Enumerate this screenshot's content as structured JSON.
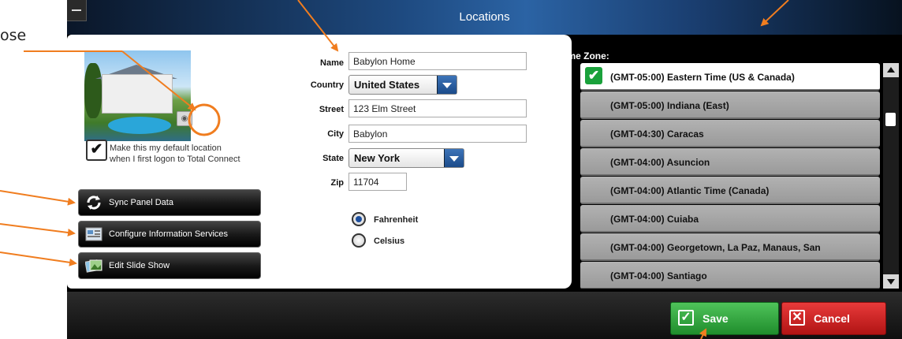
{
  "annotation": {
    "partial_text": "ose"
  },
  "window": {
    "title": "Locations"
  },
  "location": {
    "default_checkbox_label_line1": "Make this my default location",
    "default_checkbox_label_line2": "when I first logon to Total Connect",
    "default_checked": true
  },
  "actions": {
    "sync": "Sync Panel Data",
    "configure": "Configure Information Services",
    "slideshow": "Edit Slide Show"
  },
  "form": {
    "name_label": "Name",
    "name_value": "Babylon Home",
    "country_label": "Country",
    "country_value": "United States",
    "street_label": "Street",
    "street_value": "123 Elm Street",
    "city_label": "City",
    "city_value": "Babylon",
    "state_label": "State",
    "state_value": "New York",
    "zip_label": "Zip",
    "zip_value": "11704"
  },
  "temperature": {
    "options": [
      "Fahrenheit",
      "Celsius"
    ],
    "selected": "Fahrenheit"
  },
  "timezone": {
    "label": "Time Zone:",
    "items": [
      "(GMT-05:00) Eastern Time (US & Canada)",
      "(GMT-05:00) Indiana (East)",
      "(GMT-04:30) Caracas",
      "(GMT-04:00) Asuncion",
      "(GMT-04:00) Atlantic Time (Canada)",
      "(GMT-04:00) Cuiaba",
      "(GMT-04:00) Georgetown, La Paz, Manaus, San",
      "(GMT-04:00) Santiago"
    ],
    "selected_index": 0
  },
  "footer": {
    "save": "Save",
    "cancel": "Cancel"
  },
  "colors": {
    "annotation": "#f07d1f",
    "save": "#2ea83a",
    "cancel": "#d12020",
    "titlebar": "#2b63a4"
  }
}
